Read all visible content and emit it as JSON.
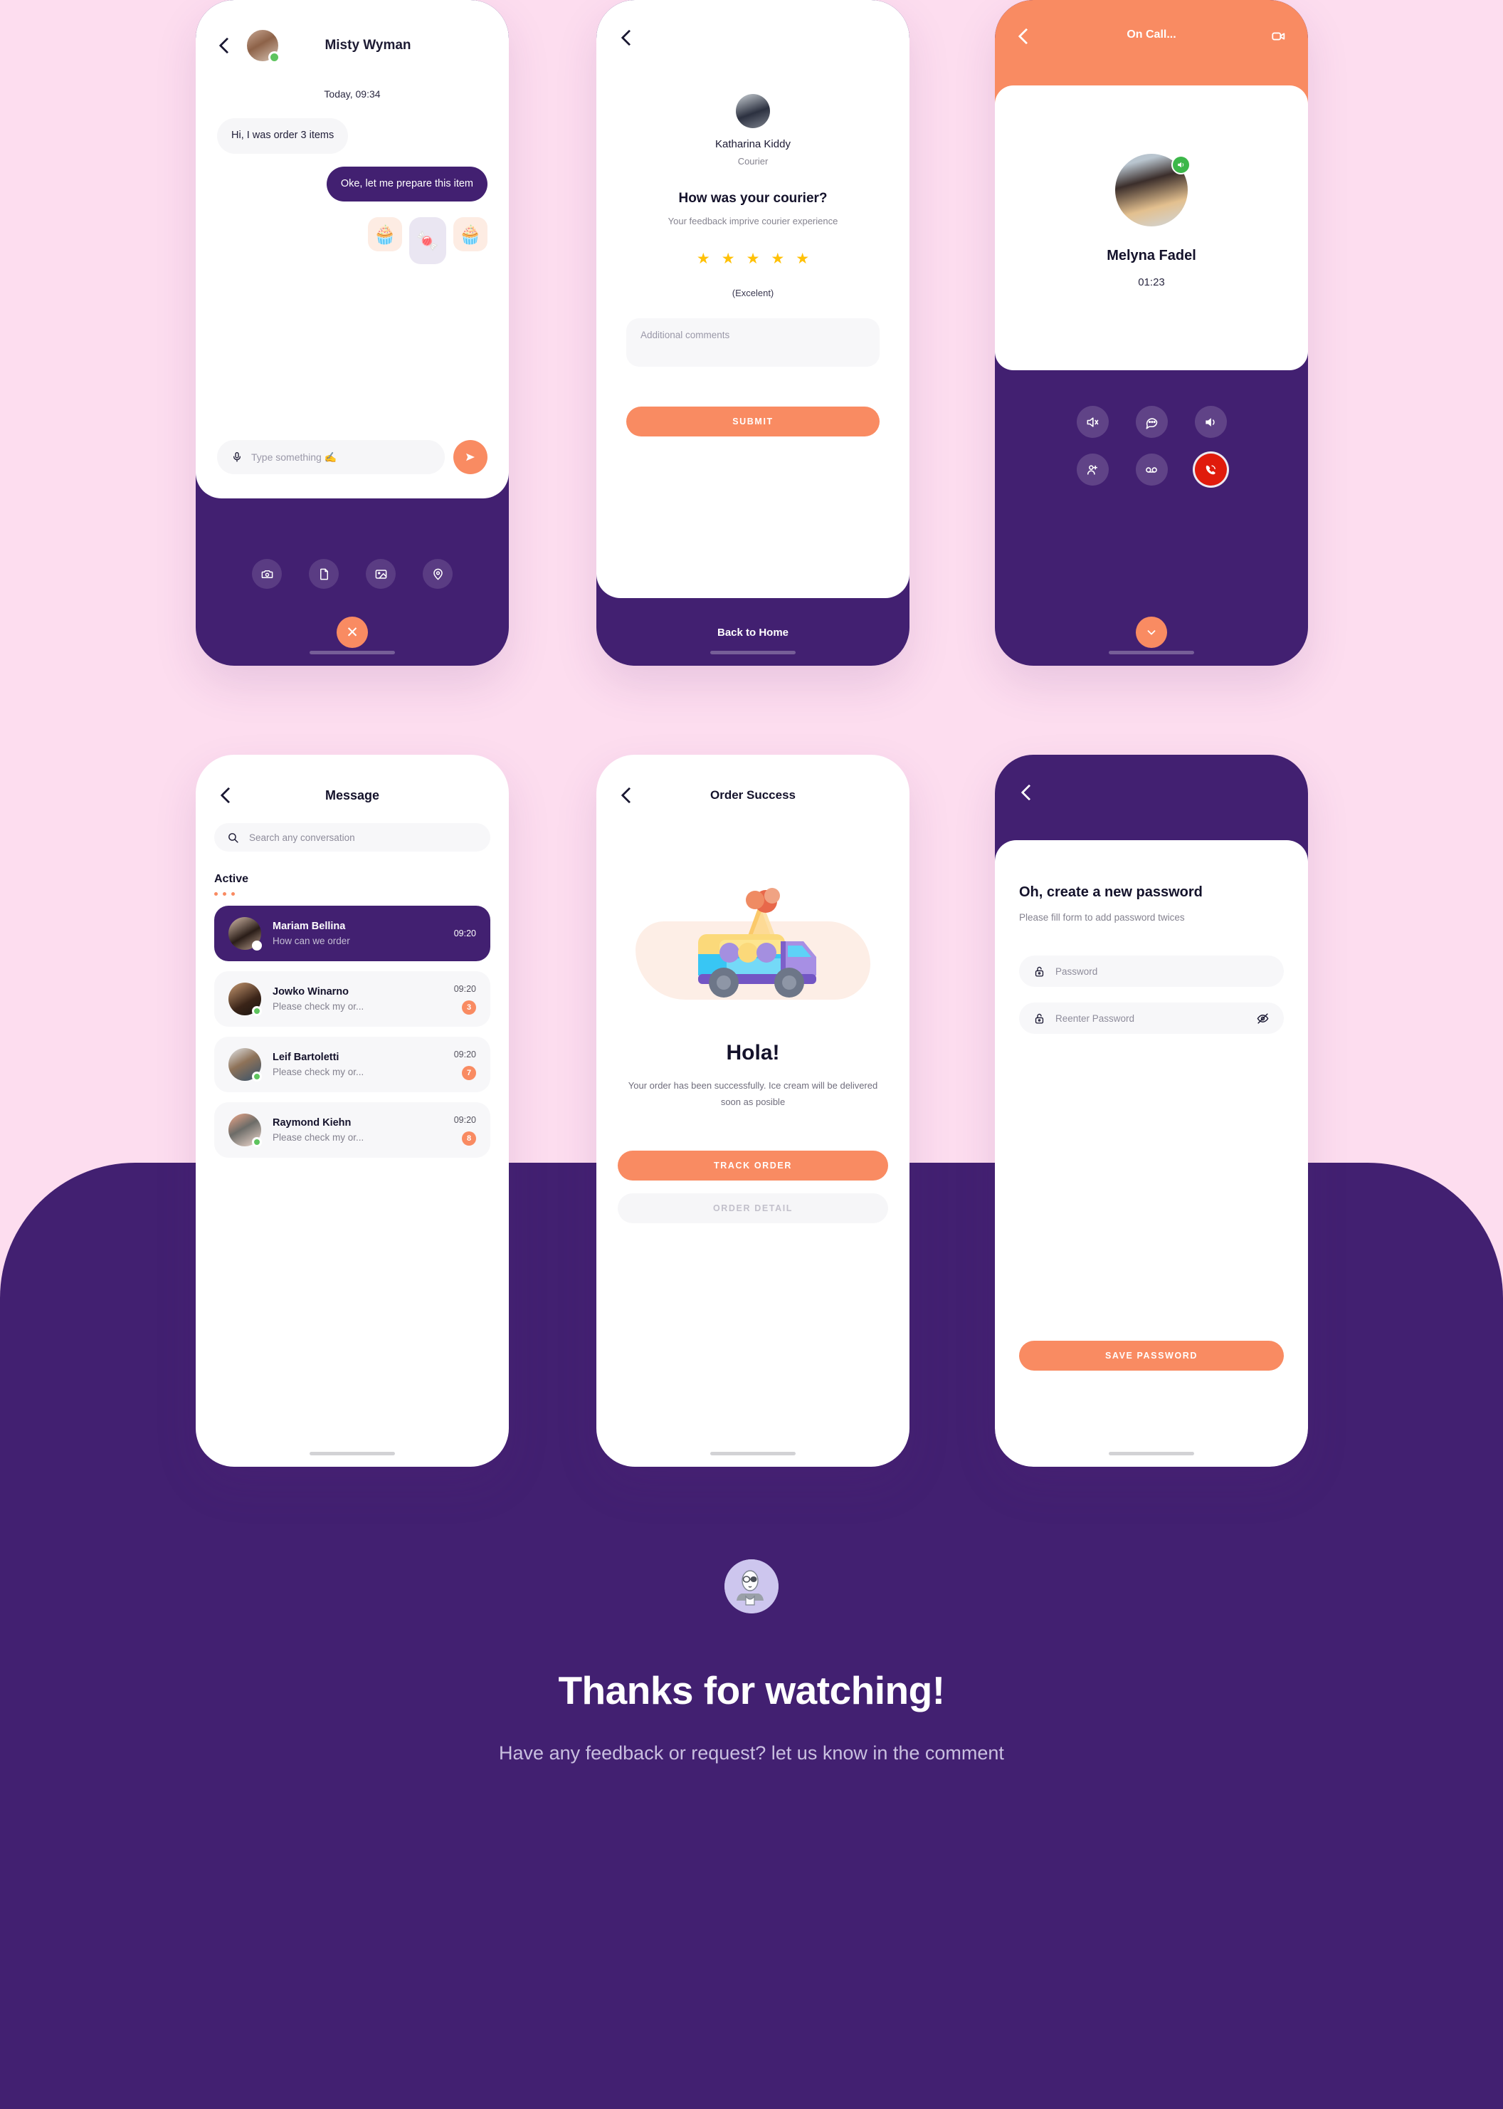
{
  "theme": {
    "background_pink": "#FDDDEF",
    "purple": "#422071",
    "orange": "#F98B62",
    "red_end_call": "#E01B0C",
    "green_online": "#5EC45E",
    "star_yellow": "#FFC107"
  },
  "chat_screen": {
    "back_icon": "chevron-left-icon",
    "contact_name": "Misty Wyman",
    "online": true,
    "timestamp": "Today, 09:34",
    "messages": [
      {
        "from": "them",
        "text": "Hi, I was order 3 items"
      },
      {
        "from": "me",
        "text": "Oke, let me prepare this item"
      }
    ],
    "stickers": [
      "🧁",
      "🍬",
      "🧁"
    ],
    "input_placeholder": "Type something ✍️",
    "mic_icon": "microphone-icon",
    "send_icon": "send-icon",
    "tray": {
      "items": [
        {
          "icon": "camera-icon",
          "label": "Camera"
        },
        {
          "icon": "file-icon",
          "label": "File"
        },
        {
          "icon": "image-icon",
          "label": "Image"
        },
        {
          "icon": "location-pin-icon",
          "label": "Location"
        }
      ],
      "close_icon": "close-icon"
    }
  },
  "feedback_screen": {
    "back_icon": "chevron-left-icon",
    "courier_name": "Katharina Kiddy",
    "courier_role": "Courier",
    "question": "How was your courier?",
    "subtitle": "Your feedback imprive courier experience",
    "stars_total": 5,
    "stars_filled": 5,
    "rating_word": "(Excelent)",
    "comment_placeholder": "Additional comments",
    "submit_label": "SUBMIT",
    "back_home_label": "Back to Home"
  },
  "call_screen": {
    "back_icon": "chevron-left-icon",
    "title": "On Call...",
    "video_icon": "video-camera-icon",
    "caller_name": "Melyna Fadel",
    "duration": "01:23",
    "speaker_badge_icon": "speaker-on-icon",
    "controls": [
      {
        "icon": "mute-icon",
        "label": "Mute"
      },
      {
        "icon": "chat-bubble-icon",
        "label": "Chat"
      },
      {
        "icon": "speaker-icon",
        "label": "Speaker"
      },
      {
        "icon": "add-person-icon",
        "label": "Add person"
      },
      {
        "icon": "voicemail-icon",
        "label": "Voicemail"
      },
      {
        "icon": "end-call-icon",
        "label": "End call"
      }
    ],
    "minimize_icon": "chevron-down-icon"
  },
  "message_screen": {
    "back_icon": "chevron-left-icon",
    "title": "Message",
    "search_placeholder": "Search any conversation",
    "search_icon": "search-icon",
    "section_label": "Active",
    "conversations": [
      {
        "name": "Mariam Bellina",
        "preview": "How can we order",
        "time": "09:20",
        "badge": "",
        "selected": true,
        "online": true
      },
      {
        "name": "Jowko Winarno",
        "preview": "Please check my or...",
        "time": "09:20",
        "badge": "3",
        "selected": false,
        "online": true
      },
      {
        "name": "Leif Bartoletti",
        "preview": "Please check my or...",
        "time": "09:20",
        "badge": "7",
        "selected": false,
        "online": true
      },
      {
        "name": "Raymond Kiehn",
        "preview": "Please check my or...",
        "time": "09:20",
        "badge": "8",
        "selected": false,
        "online": true
      }
    ]
  },
  "order_screen": {
    "back_icon": "chevron-left-icon",
    "title": "Order Success",
    "illustration": "ice-cream-truck-illustration",
    "heading": "Hola!",
    "description": "Your order has been successfully. Ice cream will be delivered soon as posible",
    "primary_label": "TRACK ORDER",
    "secondary_label": "ORDER DETAIL"
  },
  "password_screen": {
    "back_icon": "chevron-left-icon",
    "title": "Oh, create a new password",
    "subtitle": "Please fill form to add password twices",
    "fields": [
      {
        "placeholder": "Password",
        "lock_icon": "lock-open-icon",
        "eye_icon": ""
      },
      {
        "placeholder": "Reenter Password",
        "lock_icon": "lock-open-icon",
        "eye_icon": "eye-off-icon"
      }
    ],
    "save_label": "SAVE PASSWORD"
  },
  "footer": {
    "avatar_icon": "designer-avatar",
    "title": "Thanks for watching!",
    "subtitle": "Have any feedback or request? let us know in the comment"
  }
}
